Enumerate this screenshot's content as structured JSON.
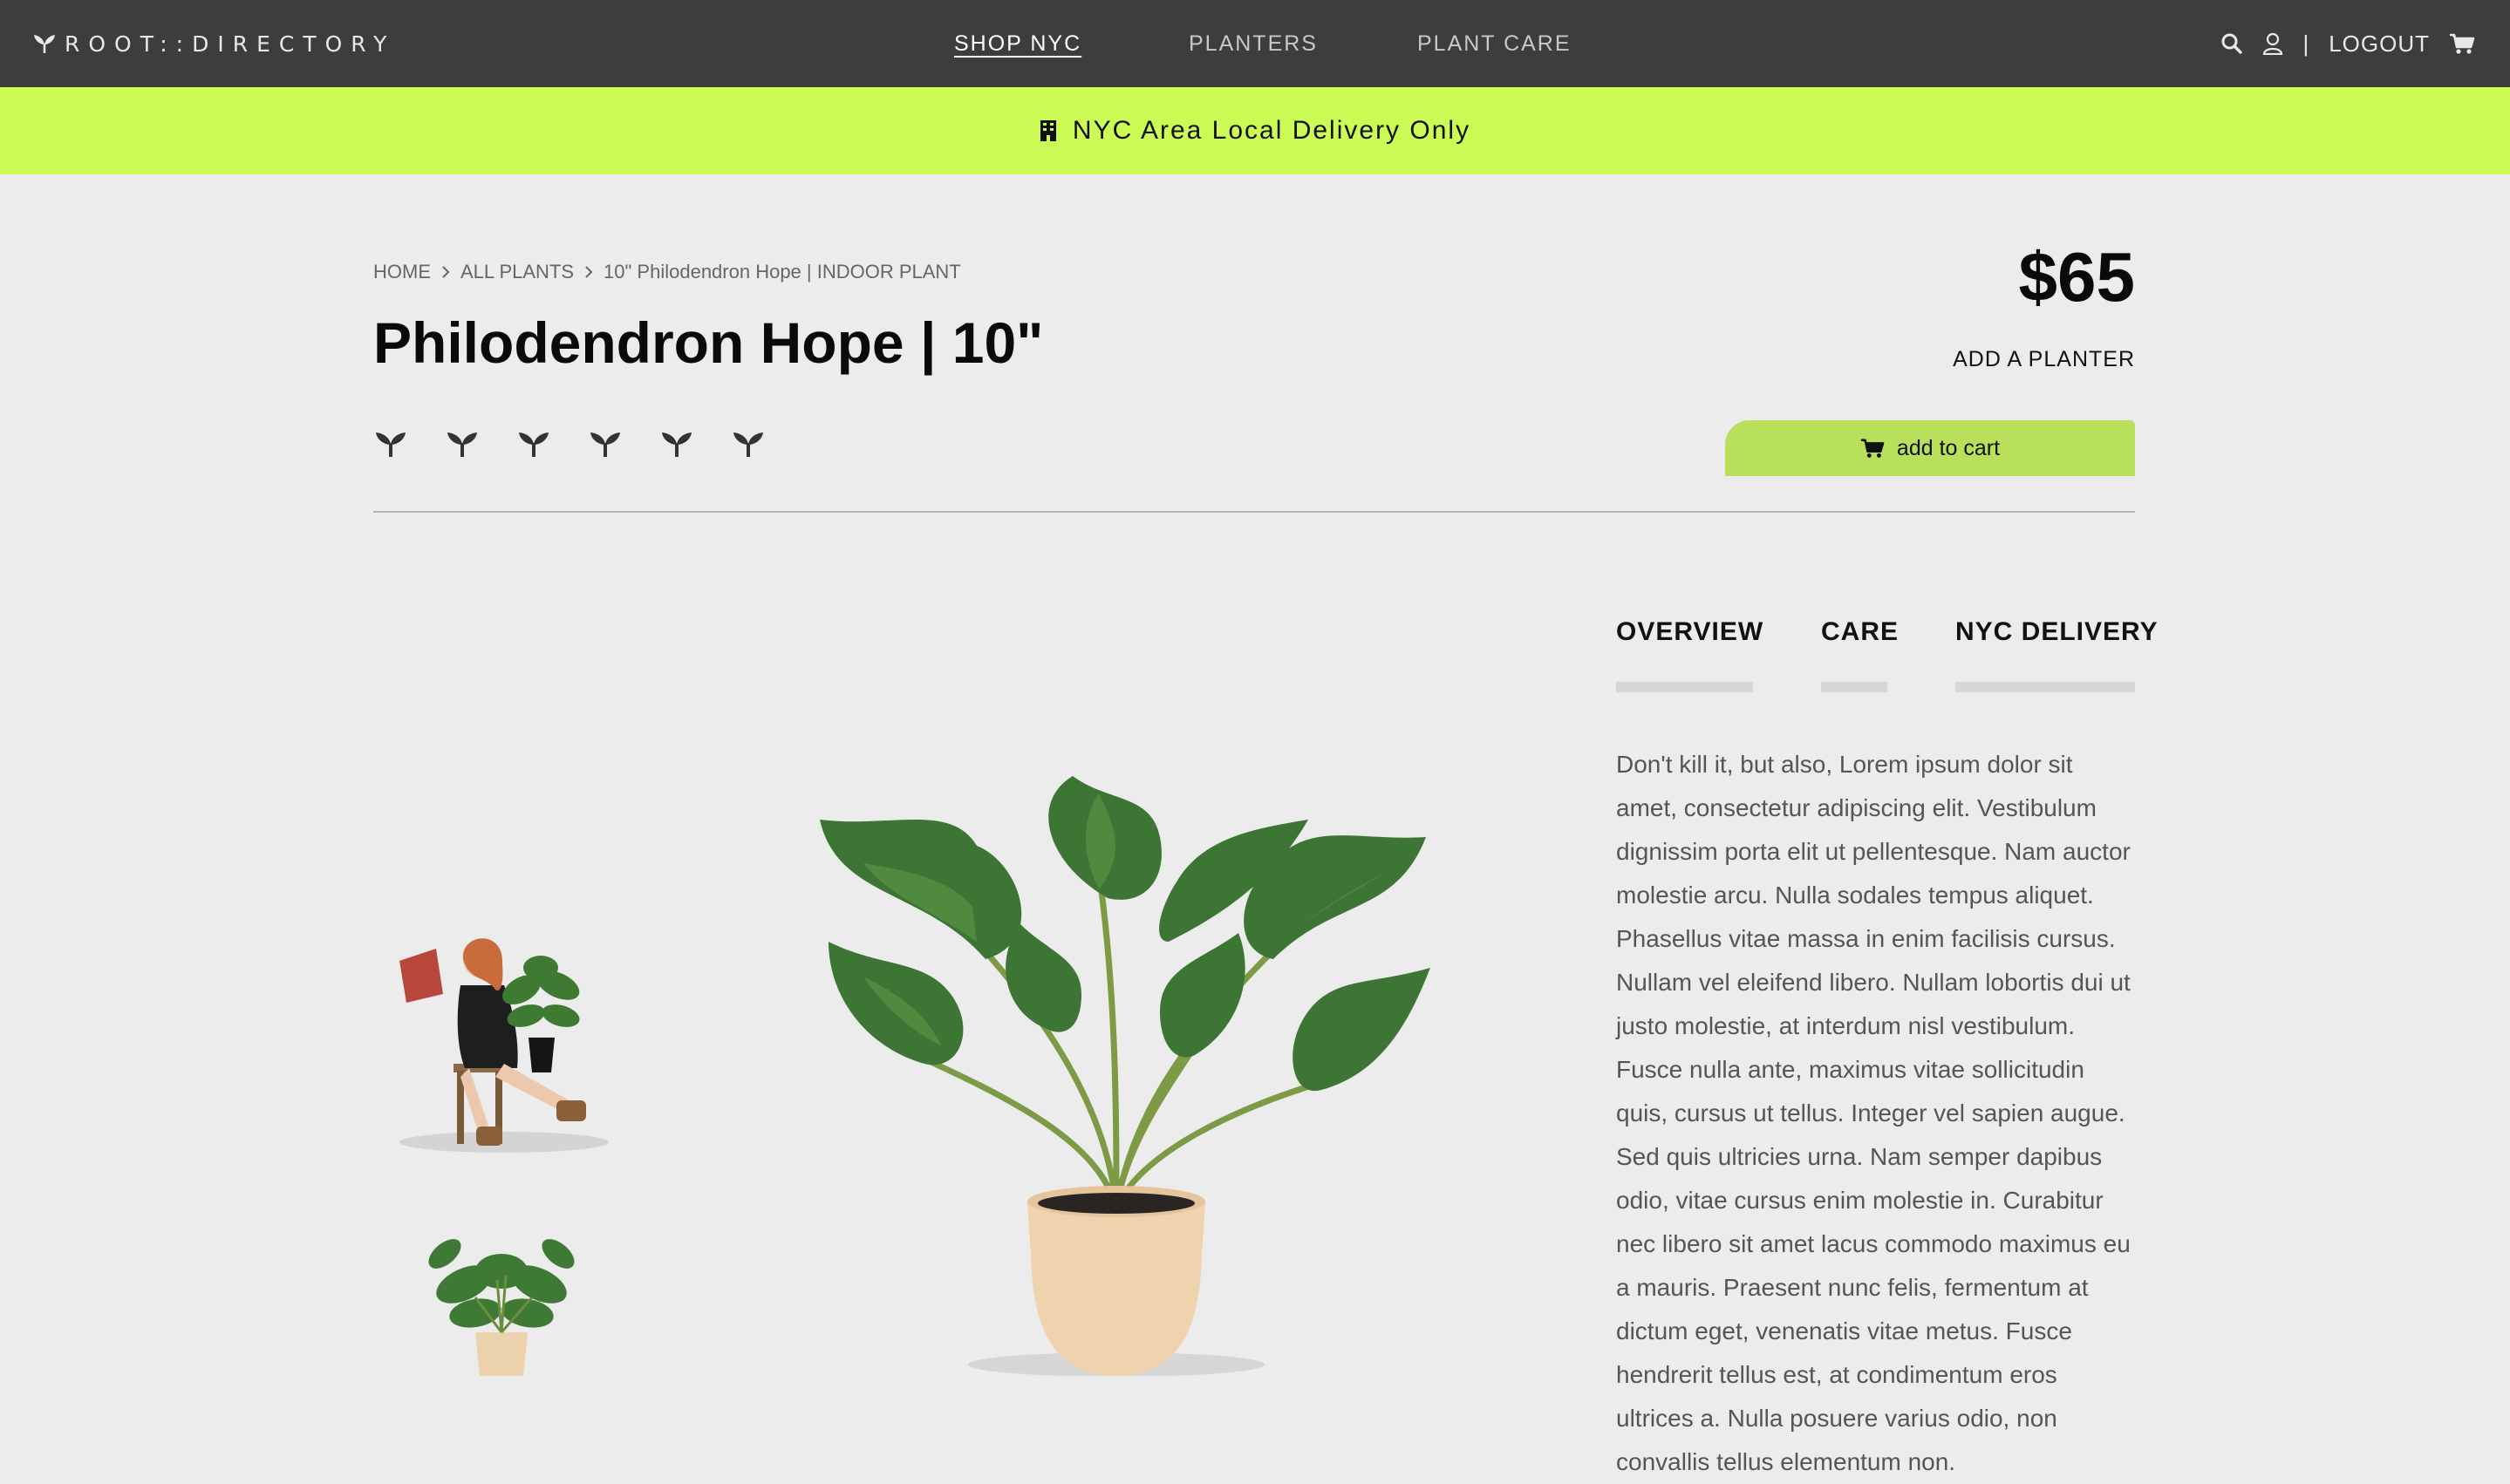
{
  "nav": {
    "brand": "ROOT::DIRECTORY",
    "links": [
      "SHOP NYC",
      "PLANTERS",
      "PLANT CARE"
    ],
    "active": "SHOP NYC",
    "logout": "LOGOUT",
    "separator": "|",
    "icons": [
      "logo-leaf-icon",
      "search-icon",
      "user-icon",
      "cart-icon"
    ]
  },
  "banner": {
    "icon": "building-icon",
    "text": "NYC Area Local Delivery Only",
    "color": "#cdfb55"
  },
  "breadcrumb": [
    "HOME",
    "ALL PLANTS",
    "10\" Philodendron Hope | INDOOR PLANT"
  ],
  "product": {
    "title": "Philodendron Hope | 10\"",
    "price": "$65",
    "add_planter": "ADD A PLANTER",
    "add_to_cart": "add to cart",
    "rating": {
      "icon": "sprout-icon",
      "count": 6
    }
  },
  "tabs": [
    "OVERVIEW",
    "CARE",
    "NYC DELIVERY"
  ],
  "description": "Don't kill it, but also, Lorem ipsum dolor sit amet, consectetur adipiscing elit. Vestibulum dignissim porta elit ut pellentesque. Nam auctor molestie arcu. Nulla sodales tempus aliquet. Phasellus vitae massa in enim facilisis cursus. Nullam vel eleifend libero. Nullam lobortis dui ut justo molestie, at interdum nisl vestibulum. Fusce nulla ante, maximus vitae sollicitudin quis, cursus ut tellus. Integer vel sapien augue. Sed quis ultricies urna. Nam semper dapibus odio, vitae cursus enim molestie in. Curabitur nec libero sit amet lacus commodo maximus eu a mauris. Praesent nunc felis, fermentum at dictum eget, venenatis vitae metus. Fusce hendrerit tellus est, at condimentum eros ultrices a. Nulla posuere varius odio, non convallis tellus elementum non.",
  "colors": {
    "topbar": "#3d3d3d",
    "accent": "#cdfb55",
    "button": "#b9e05a",
    "background": "#ececec"
  }
}
